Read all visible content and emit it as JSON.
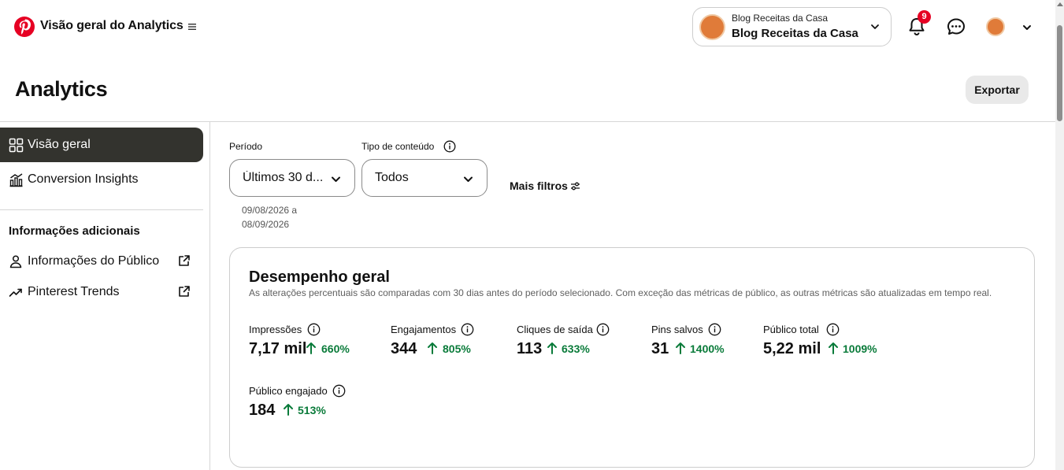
{
  "app": {
    "title": "Visão geral do Analytics"
  },
  "account": {
    "small_label": "Blog Receitas da Casa",
    "name": "Blog Receitas da Casa",
    "accent_color": "#e07b39"
  },
  "notifications": {
    "count": "9",
    "badge_color": "#e60023"
  },
  "page": {
    "title": "Analytics",
    "export_label": "Exportar"
  },
  "sidebar": {
    "items": [
      {
        "label": "Visão geral",
        "icon": "grid-icon",
        "active": true
      },
      {
        "label": "Conversion Insights",
        "icon": "bar-chart-icon",
        "active": false
      }
    ],
    "section_title": "Informações adicionais",
    "links": [
      {
        "label": "Informações do Público",
        "icon": "person-icon",
        "external": true
      },
      {
        "label": "Pinterest Trends",
        "icon": "trend-icon",
        "external": true
      }
    ]
  },
  "filters": {
    "period_label": "Período",
    "period_value": "Últimos 30 d...",
    "content_type_label": "Tipo de conteúdo",
    "content_type_value": "Todos",
    "date_range_start": "09/08/2026 a",
    "date_range_end": "08/09/2026",
    "more_filters_label": "Mais filtros"
  },
  "overview": {
    "title": "Desempenho geral",
    "subtitle": "As alterações percentuais são comparadas com 30 dias antes do período selecionado. Com exceção das métricas de público, as outras métricas são atualizadas em tempo real.",
    "metrics": [
      {
        "label": "Impressões",
        "value": "7,17 mil",
        "change": "660%"
      },
      {
        "label": "Engajamentos",
        "value": "344",
        "change": "805%"
      },
      {
        "label": "Cliques de saída",
        "value": "113",
        "change": "633%"
      },
      {
        "label": "Pins salvos",
        "value": "31",
        "change": "1400%"
      },
      {
        "label": "Público total",
        "value": "5,22 mil",
        "change": "1009%"
      },
      {
        "label": "Público engajado",
        "value": "184",
        "change": "513%"
      }
    ],
    "positive_color": "#0a7b3a"
  }
}
